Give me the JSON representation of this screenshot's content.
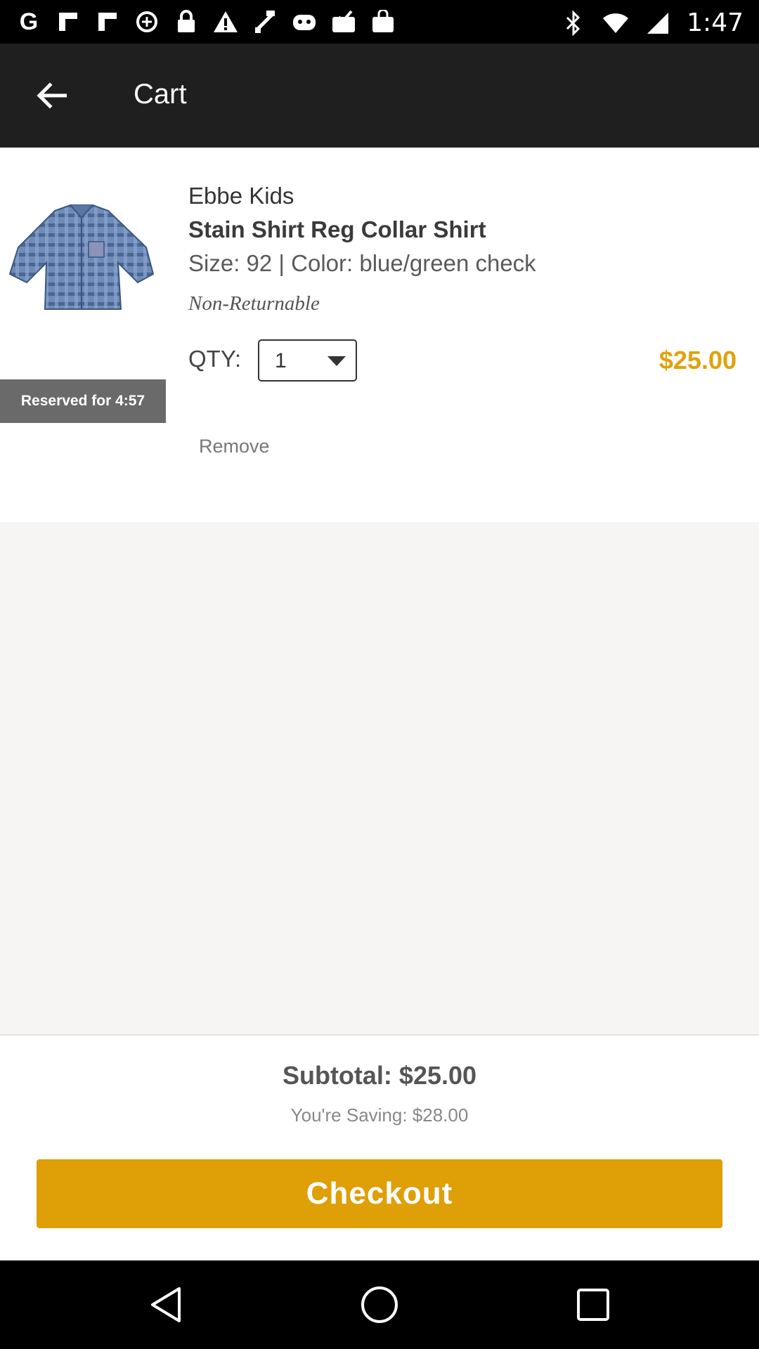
{
  "status_bar": {
    "time": "1:47",
    "left_icons": [
      "google-icon",
      "flipboard-icon",
      "flipboard-icon",
      "data-saver-icon",
      "lock-icon",
      "warning-icon",
      "fake-gps-icon",
      "bot-icon",
      "inbox-check-icon",
      "shopping-bag-icon"
    ],
    "right_icons": [
      "bluetooth-icon",
      "wifi-icon",
      "signal-icon"
    ]
  },
  "app_bar": {
    "title": "Cart",
    "back_icon": "arrow-back-icon"
  },
  "cart_item": {
    "brand": "Ebbe Kids",
    "name": "Stain Shirt Reg Collar Shirt",
    "variant": "Size: 92 | Color: blue/green check",
    "returnable": "Non-Returnable",
    "qty_label": "QTY:",
    "qty_value": "1",
    "price": "$25.00",
    "reserved": "Reserved for 4:57",
    "remove_label": "Remove"
  },
  "summary": {
    "subtotal": "Subtotal: $25.00",
    "saving": "You're Saving: $28.00",
    "checkout_label": "Checkout"
  },
  "colors": {
    "accent": "#df9f06",
    "price": "#e1a20a",
    "app_bar": "#1f1f1f"
  }
}
